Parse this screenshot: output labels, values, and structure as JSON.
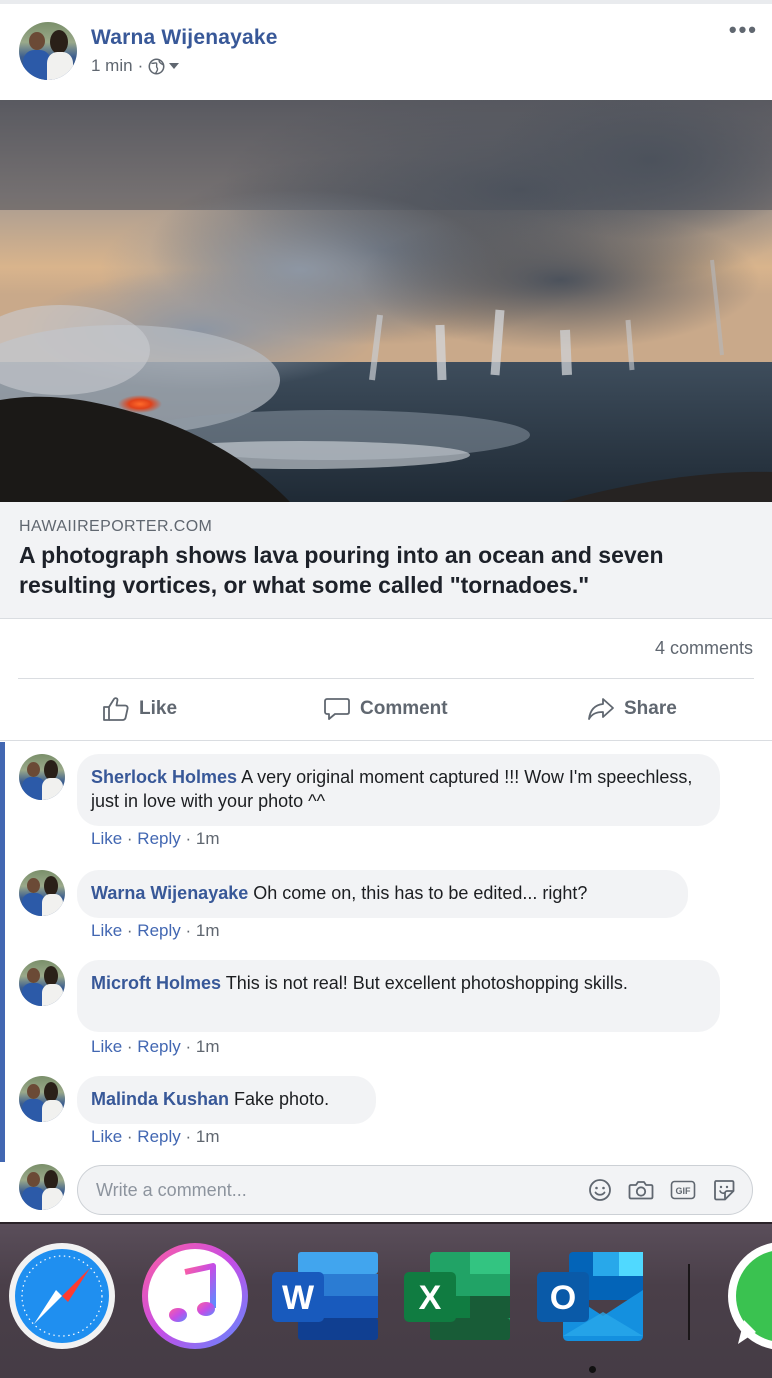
{
  "post": {
    "author": "Warna Wijenayake",
    "time": "1 min",
    "dot": "·",
    "more": "•••"
  },
  "link": {
    "domain": "HAWAIIREPORTER.COM",
    "title": "A photograph shows lava pouring into an ocean and seven resulting vortices, or what some called \"tornadoes.\""
  },
  "stats": {
    "comments": "4 comments"
  },
  "actions": {
    "like": "Like",
    "comment": "Comment",
    "share": "Share"
  },
  "comments": [
    {
      "name": "Sherlock Holmes",
      "text": " A very original moment captured !!! Wow I'm speechless, just in love with your photo ^^",
      "like": "Like",
      "reply": "Reply",
      "time": "1m"
    },
    {
      "name": "Warna Wijenayake",
      "text": " Oh come on, this has to be edited... right?",
      "like": "Like",
      "reply": "Reply",
      "time": "1m"
    },
    {
      "name": "Microft Holmes",
      "text": " This is not real! But excellent photoshopping skills.",
      "like": "Like",
      "reply": "Reply",
      "time": "1m"
    },
    {
      "name": "Malinda Kushan",
      "text": " Fake photo.",
      "like": "Like",
      "reply": "Reply",
      "time": "1m"
    }
  ],
  "composer": {
    "placeholder": "Write a comment...",
    "gif_label": "GIF"
  },
  "dock": {
    "apps": [
      "safari",
      "itunes",
      "word",
      "excel",
      "outlook",
      "whatsapp"
    ],
    "word_letter": "W",
    "excel_letter": "X",
    "outlook_letter": "O"
  },
  "colors": {
    "link_blue": "#385898",
    "accent_blue": "#4267b2",
    "meta_gray": "#606770",
    "bubble_bg": "#f2f3f5"
  }
}
